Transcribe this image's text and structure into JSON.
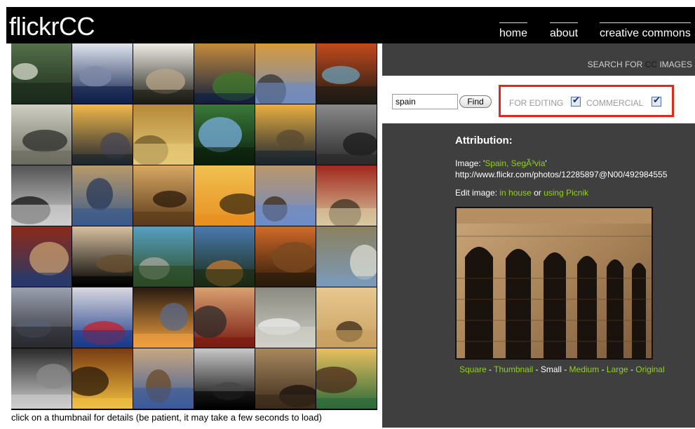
{
  "app": {
    "logo": "flickrCC"
  },
  "nav": {
    "home": "home",
    "about": "about",
    "cc": "creative commons"
  },
  "search": {
    "label_prefix": "SEARCH FOR ",
    "label_cc": "CC",
    "label_suffix": " IMAGES",
    "query": "spain",
    "find_label": "Find",
    "for_editing_label": "FOR EDITING",
    "commercial_label": "COMMERCIAL",
    "for_editing_checked": true,
    "commercial_checked": true
  },
  "attribution": {
    "title": "Attribution:",
    "image_prefix": "Image: '",
    "image_title": "Spain, SegÃ³via",
    "image_suffix": "'",
    "url": "http://www.flickr.com/photos/12285897@N00/492984555",
    "edit_prefix": "Edit image: ",
    "in_house": "in house",
    "or": " or ",
    "picnik": "using Picnik"
  },
  "sizes": {
    "square": "Square",
    "sep": " - ",
    "thumbnail": "Thumbnail",
    "small": "Small",
    "medium": "Medium",
    "large": "Large",
    "original": "Original"
  },
  "caption": "click on a thumbnail for details (be patient, it may take a few seconds to load)",
  "colors": {
    "link": "#8fd11c",
    "panel": "#3f3f3f",
    "highlight_border": "#e0281e"
  },
  "thumbnails": [
    "forest-path",
    "white-sculpture",
    "white-deer",
    "basilica-night",
    "city-tower",
    "rock-coast",
    "lone-tree-sea",
    "sunset-sea",
    "wheat-field-tree",
    "tiny-planet",
    "golden-coast",
    "stair-hall",
    "beach-bw",
    "mountain-village",
    "arched-corridor",
    "orange-field",
    "aqueduct",
    "matador",
    "coast-cliffs",
    "leaning-tower",
    "mountain-lake",
    "rocky-bay",
    "old-street",
    "mountain-ruins",
    "metal-sculpture",
    "residential-building",
    "sunset-ship",
    "abstract-red",
    "sand-dunes",
    "yellow-window",
    "bw-portrait",
    "dry-hills",
    "stone-house",
    "moon",
    "stone-arch",
    "gaudi-dragon"
  ]
}
